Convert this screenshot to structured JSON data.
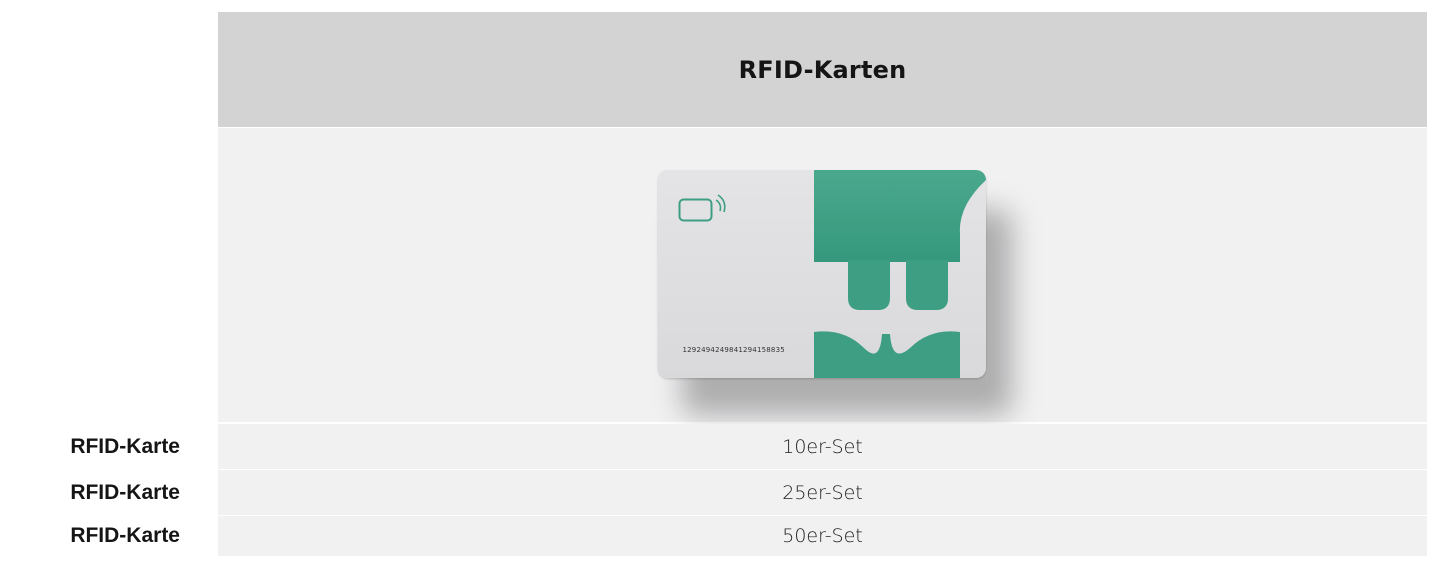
{
  "table": {
    "header": {
      "title": "RFID-Karten"
    },
    "product_image": {
      "card_number": "1292494249841294158835",
      "icons": [
        "contactless-chip-icon",
        "plug-logo-icon"
      ],
      "colors": {
        "brand_green": "#3d9e83",
        "card_grey": "#e0e0e2"
      }
    },
    "rows": [
      {
        "label": "RFID-Karte",
        "value": "10er-Set"
      },
      {
        "label": "RFID-Karte",
        "value": "25er-Set"
      },
      {
        "label": "RFID-Karte",
        "value": "50er-Set"
      }
    ]
  }
}
